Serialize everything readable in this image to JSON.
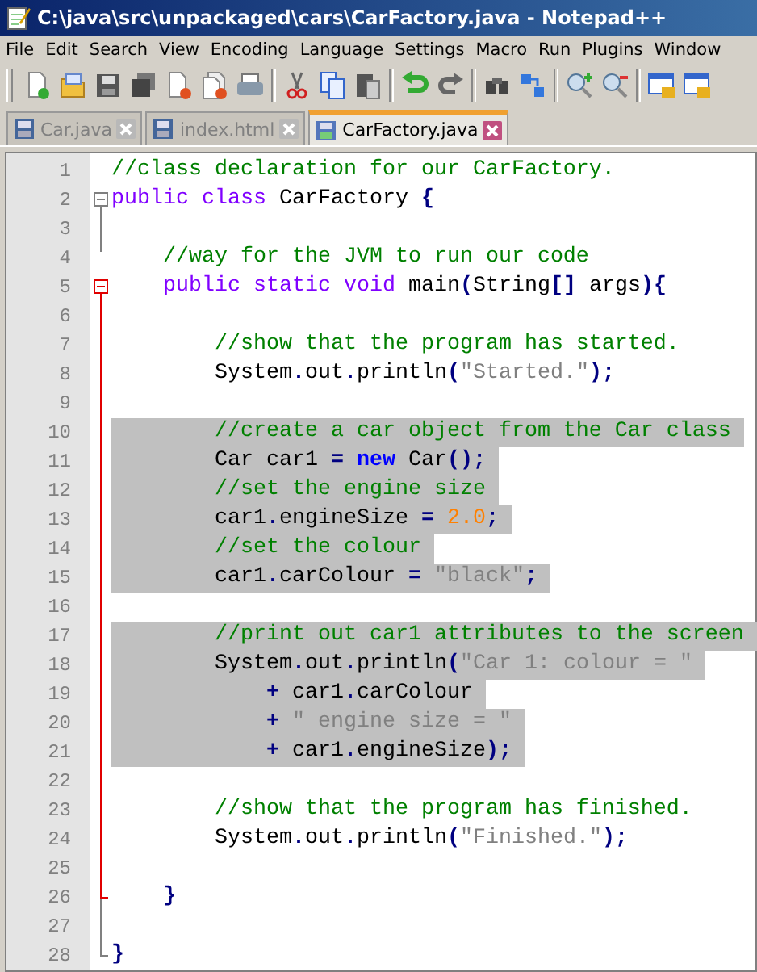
{
  "window": {
    "title": "C:\\java\\src\\unpackaged\\cars\\CarFactory.java - Notepad++"
  },
  "menu": [
    "File",
    "Edit",
    "Search",
    "View",
    "Encoding",
    "Language",
    "Settings",
    "Macro",
    "Run",
    "Plugins",
    "Window"
  ],
  "tabs": [
    {
      "label": "Car.java",
      "selected": false
    },
    {
      "label": "index.html",
      "selected": false
    },
    {
      "label": "CarFactory.java",
      "selected": true
    }
  ],
  "editor": {
    "lines": [
      {
        "number": "1",
        "selected": false,
        "tokens": [
          {
            "kind": "comment",
            "text": "//class declaration for our CarFactory."
          }
        ]
      },
      {
        "number": "2",
        "selected": false,
        "tokens": [
          {
            "kind": "keyword",
            "text": "public class"
          },
          {
            "kind": "plain",
            "text": " CarFactory "
          },
          {
            "kind": "operator",
            "text": "{"
          }
        ]
      },
      {
        "number": "3"
      },
      {
        "number": "4",
        "selected": false,
        "tokens": [
          {
            "kind": "comment",
            "text": "    //way for the JVM to run our code"
          }
        ]
      },
      {
        "number": "5",
        "selected": false,
        "tokens": [
          {
            "kind": "keyword",
            "text": "    public static void"
          },
          {
            "kind": "plain",
            "text": " main"
          },
          {
            "kind": "operator",
            "text": "("
          },
          {
            "kind": "plain",
            "text": "String"
          },
          {
            "kind": "operator",
            "text": "[]"
          },
          {
            "kind": "plain",
            "text": " args"
          },
          {
            "kind": "operator",
            "text": "){"
          }
        ]
      },
      {
        "number": "6"
      },
      {
        "number": "7",
        "selected": false,
        "tokens": [
          {
            "kind": "comment",
            "text": "        //show that the program has started."
          }
        ]
      },
      {
        "number": "8",
        "selected": false,
        "tokens": [
          {
            "kind": "plain",
            "text": "        System"
          },
          {
            "kind": "operator",
            "text": "."
          },
          {
            "kind": "plain",
            "text": "out"
          },
          {
            "kind": "operator",
            "text": "."
          },
          {
            "kind": "plain",
            "text": "println"
          },
          {
            "kind": "operator",
            "text": "("
          },
          {
            "kind": "string",
            "text": "\"Started.\""
          },
          {
            "kind": "operator",
            "text": ");"
          }
        ]
      },
      {
        "number": "9"
      },
      {
        "number": "10",
        "selected": true,
        "tokens": [
          {
            "kind": "comment",
            "text": "        //create a car object from the Car class"
          }
        ]
      },
      {
        "number": "11",
        "selected": true,
        "tokens": [
          {
            "kind": "plain",
            "text": "        Car car1 "
          },
          {
            "kind": "operator",
            "text": "="
          },
          {
            "kind": "new",
            "text": " new"
          },
          {
            "kind": "plain",
            "text": " Car"
          },
          {
            "kind": "operator",
            "text": "();"
          }
        ]
      },
      {
        "number": "12",
        "selected": true,
        "tokens": [
          {
            "kind": "comment",
            "text": "        //set the engine size"
          }
        ]
      },
      {
        "number": "13",
        "selected": true,
        "tokens": [
          {
            "kind": "plain",
            "text": "        car1"
          },
          {
            "kind": "operator",
            "text": "."
          },
          {
            "kind": "plain",
            "text": "engineSize "
          },
          {
            "kind": "operator",
            "text": "="
          },
          {
            "kind": "number",
            "text": " 2.0"
          },
          {
            "kind": "operator",
            "text": ";"
          }
        ]
      },
      {
        "number": "14",
        "selected": true,
        "tokens": [
          {
            "kind": "comment",
            "text": "        //set the colour"
          }
        ]
      },
      {
        "number": "15",
        "selected": true,
        "tokens": [
          {
            "kind": "plain",
            "text": "        car1"
          },
          {
            "kind": "operator",
            "text": "."
          },
          {
            "kind": "plain",
            "text": "carColour "
          },
          {
            "kind": "operator",
            "text": "="
          },
          {
            "kind": "string",
            "text": " \"black\""
          },
          {
            "kind": "operator",
            "text": ";"
          }
        ]
      },
      {
        "number": "16"
      },
      {
        "number": "17",
        "selected": true,
        "tokens": [
          {
            "kind": "comment",
            "text": "        //print out car1 attributes to the screen"
          }
        ]
      },
      {
        "number": "18",
        "selected": true,
        "tokens": [
          {
            "kind": "plain",
            "text": "        System"
          },
          {
            "kind": "operator",
            "text": "."
          },
          {
            "kind": "plain",
            "text": "out"
          },
          {
            "kind": "operator",
            "text": "."
          },
          {
            "kind": "plain",
            "text": "println"
          },
          {
            "kind": "operator",
            "text": "("
          },
          {
            "kind": "string",
            "text": "\"Car 1: colour = \""
          }
        ]
      },
      {
        "number": "19",
        "selected": true,
        "tokens": [
          {
            "kind": "operator",
            "text": "            +"
          },
          {
            "kind": "plain",
            "text": " car1"
          },
          {
            "kind": "operator",
            "text": "."
          },
          {
            "kind": "plain",
            "text": "carColour"
          }
        ]
      },
      {
        "number": "20",
        "selected": true,
        "tokens": [
          {
            "kind": "operator",
            "text": "            +"
          },
          {
            "kind": "string",
            "text": " \" engine size = \""
          }
        ]
      },
      {
        "number": "21",
        "selected": true,
        "tokens": [
          {
            "kind": "operator",
            "text": "            +"
          },
          {
            "kind": "plain",
            "text": " car1"
          },
          {
            "kind": "operator",
            "text": "."
          },
          {
            "kind": "plain",
            "text": "engineSize"
          },
          {
            "kind": "operator",
            "text": ");"
          }
        ]
      },
      {
        "number": "22"
      },
      {
        "number": "23",
        "selected": false,
        "tokens": [
          {
            "kind": "comment",
            "text": "        //show that the program has finished."
          }
        ]
      },
      {
        "number": "24",
        "selected": false,
        "tokens": [
          {
            "kind": "plain",
            "text": "        System"
          },
          {
            "kind": "operator",
            "text": "."
          },
          {
            "kind": "plain",
            "text": "out"
          },
          {
            "kind": "operator",
            "text": "."
          },
          {
            "kind": "plain",
            "text": "println"
          },
          {
            "kind": "operator",
            "text": "("
          },
          {
            "kind": "string",
            "text": "\"Finished.\""
          },
          {
            "kind": "operator",
            "text": ");"
          }
        ]
      },
      {
        "number": "25"
      },
      {
        "number": "26",
        "selected": false,
        "tokens": [
          {
            "kind": "operator",
            "text": "    }"
          }
        ]
      },
      {
        "number": "27"
      },
      {
        "number": "28",
        "selected": false,
        "tokens": [
          {
            "kind": "operator",
            "text": "}"
          }
        ]
      }
    ]
  }
}
